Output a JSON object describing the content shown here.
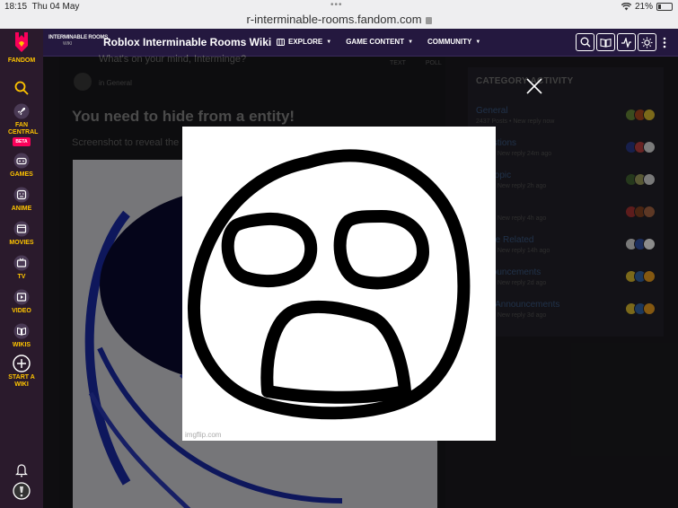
{
  "status_bar": {
    "time": "18:15",
    "date": "Thu 04 May",
    "url": "r-interminable-rooms.fandom.com",
    "battery": "21%"
  },
  "rail": {
    "items": [
      {
        "id": "fandom",
        "label": "FANDOM",
        "icon": "fandom-logo-icon"
      },
      {
        "id": "search",
        "label": "",
        "icon": "search-icon"
      },
      {
        "id": "fan-central",
        "label": "FAN CENTRAL",
        "badge": "BETA",
        "icon": "rocket-icon"
      },
      {
        "id": "games",
        "label": "GAMES",
        "icon": "gamepad-icon"
      },
      {
        "id": "anime",
        "label": "ANIME",
        "icon": "anime-face-icon"
      },
      {
        "id": "movies",
        "label": "MOVIES",
        "icon": "clapperboard-icon"
      },
      {
        "id": "tv",
        "label": "TV",
        "icon": "tv-icon"
      },
      {
        "id": "video",
        "label": "VIDEO",
        "icon": "play-icon"
      },
      {
        "id": "wikis",
        "label": "WIKIS",
        "icon": "book-icon"
      },
      {
        "id": "start-a-wiki",
        "label": "START A WIKI",
        "icon": "plus-circle-icon"
      }
    ],
    "bottom_icons": [
      "bell-icon",
      "user-avatar-icon"
    ]
  },
  "wiki_nav": {
    "logo_text": "INTERMINABLE ROOMS",
    "logo_sub": "WIKI",
    "title": "Roblox Interminable Rooms Wiki",
    "menus": [
      "EXPLORE",
      "GAME CONTENT",
      "COMMUNITY"
    ],
    "tools": [
      "search-icon",
      "reader-icon",
      "activity-icon",
      "theme-icon",
      "more-icon"
    ]
  },
  "post": {
    "composer_placeholder": "What's on your mind, Interminge?",
    "text_tab": "TEXT",
    "poll_tab": "POLL",
    "category": "in General",
    "title": "You need to hide from a entity!",
    "body": "Screenshot to reveal the"
  },
  "sidebar": {
    "title": "CATEGORY ACTIVITY",
    "categories": [
      {
        "name": "General",
        "meta": "2437 Posts • New reply now",
        "colors": [
          "#6b8a3a",
          "#b04a20",
          "#e0c030"
        ]
      },
      {
        "name": "Questions",
        "meta": "Posts • New reply 24m ago",
        "colors": [
          "#2a3a8a",
          "#c04040",
          "#e0e0e0"
        ]
      },
      {
        "name": "Off Topic",
        "meta": "Posts • New reply 2h ago",
        "colors": [
          "#446633",
          "#a0a060",
          "#dddddd"
        ]
      },
      {
        "name": "Art",
        "meta": "Posts • New reply 4h ago",
        "colors": [
          "#aa3333",
          "#884422",
          "#aa6644"
        ]
      },
      {
        "name": "Game Related",
        "meta": "Posts • New reply 14h ago",
        "colors": [
          "#dddddd",
          "#3355aa",
          "#ffffff"
        ]
      },
      {
        "name": "Announcements",
        "meta": "Posts • New reply 2d ago",
        "colors": [
          "#e0c030",
          "#3366aa",
          "#f0a020"
        ]
      },
      {
        "name": "Wiki Announcements",
        "meta": "Posts • New reply 3d ago",
        "colors": [
          "#e0c030",
          "#3366aa",
          "#f0a020"
        ]
      }
    ]
  },
  "lightbox": {
    "close_icon": "close-icon",
    "watermark": "imgflip.com"
  }
}
